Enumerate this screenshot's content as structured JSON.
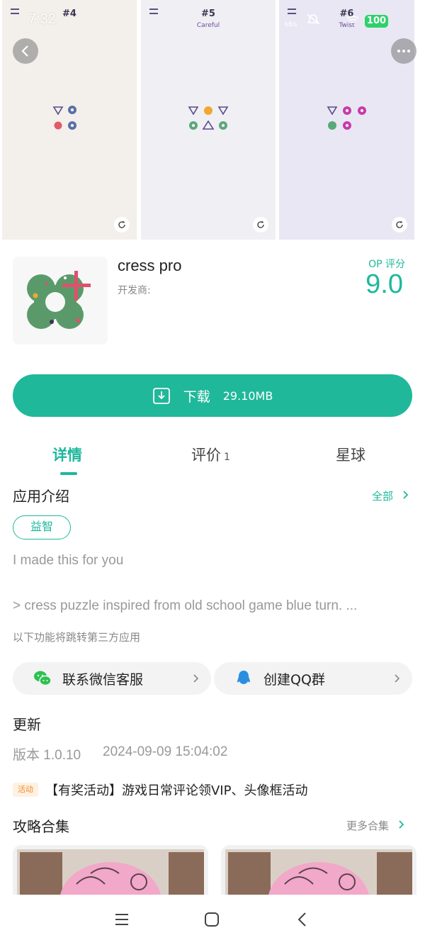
{
  "status_bar": {
    "time": "7:32",
    "battery": "100",
    "net_speed": "KB/s"
  },
  "screenshots": [
    {
      "level": "#4",
      "subtitle": ""
    },
    {
      "level": "#5",
      "subtitle": "Careful"
    },
    {
      "level": "#6",
      "subtitle": "Twist"
    }
  ],
  "app": {
    "name": "cress pro",
    "developer_label": "开发商:",
    "score_label": "OP 评分",
    "score": "9.0"
  },
  "download": {
    "label": "下载",
    "size": "29.10MB"
  },
  "tabs": [
    {
      "label": "详情",
      "active": true
    },
    {
      "label": "评价",
      "count": "1"
    },
    {
      "label": "星球"
    }
  ],
  "intro": {
    "title": "应用介绍",
    "all_label": "全部",
    "tag": "益智",
    "line1": "I made this for you",
    "line2": "> cress puzzle inspired from old school game blue turn. ..."
  },
  "third_party": {
    "note": "以下功能将跳转第三方应用",
    "wechat_label": "联系微信客服",
    "qq_label": "创建QQ群"
  },
  "update": {
    "title": "更新",
    "version": "版本 1.0.10",
    "date": "2024-09-09 15:04:02"
  },
  "activity": {
    "badge": "活动",
    "text": "【有奖活动】游戏日常评论领VIP、头像框活动"
  },
  "guides": {
    "title": "攻略合集",
    "more_label": "更多合集"
  },
  "colors": {
    "accent": "#1eb89c"
  }
}
